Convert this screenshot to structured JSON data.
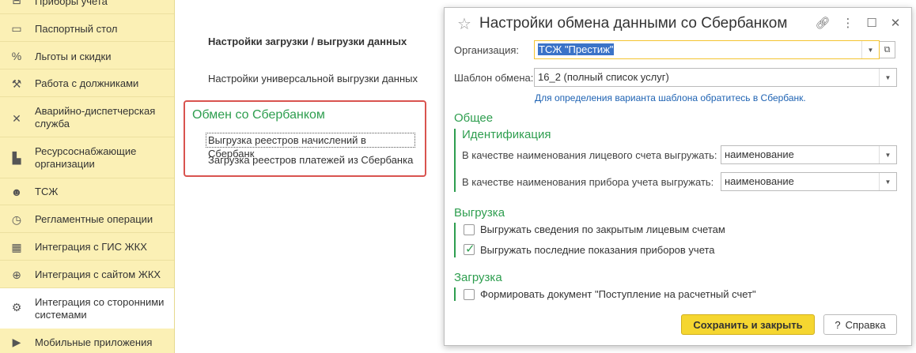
{
  "sidebar": {
    "items": [
      {
        "label": "Приборы учета",
        "icon": "meter-icon"
      },
      {
        "label": "Паспортный стол",
        "icon": "passport-icon"
      },
      {
        "label": "Льготы и скидки",
        "icon": "percent-icon"
      },
      {
        "label": "Работа с должниками",
        "icon": "gavel-icon"
      },
      {
        "label": "Аварийно-диспетчерская служба",
        "icon": "wrench-icon"
      },
      {
        "label": "Ресурсоснабжающие организации",
        "icon": "factory-icon"
      },
      {
        "label": "ТСЖ",
        "icon": "people-icon"
      },
      {
        "label": "Регламентные операции",
        "icon": "clock-icon"
      },
      {
        "label": "Интеграция с ГИС ЖКХ",
        "icon": "building-icon"
      },
      {
        "label": "Интеграция с сайтом ЖКХ",
        "icon": "globe-icon"
      },
      {
        "label": "Интеграция со сторонними системами",
        "icon": "gear-icon"
      },
      {
        "label": "Мобильные приложения",
        "icon": "play-icon"
      }
    ]
  },
  "middle": {
    "title": "Настройки загрузки / выгрузки данных",
    "universal_link": "Настройки универсальной выгрузки данных",
    "sber_title": "Обмен со Сбербанком",
    "sber_link1": "Выгрузка реестров начислений в Сбербанк",
    "sber_link2": "Загрузка реестров платежей из Сбербанка"
  },
  "dialog": {
    "title": "Настройки обмена данными со Сбербанком",
    "org_label": "Организация:",
    "org_value": "ТСЖ \"Престиж\"",
    "template_label": "Шаблон обмена:",
    "template_value": "16_2 (полный список услуг)",
    "hint": "Для определения варианта шаблона обратитесь в Сбербанк.",
    "general": "Общее",
    "identification": "Идентификация",
    "account_label": "В качестве наименования лицевого счета выгружать:",
    "account_value": "наименование",
    "meter_label": "В качестве наименования прибора учета выгружать:",
    "meter_value": "наименование",
    "export": "Выгрузка",
    "chk1_label": "Выгружать сведения по закрытым лицевым счетам",
    "chk1_checked": false,
    "chk2_label": "Выгружать последние показания приборов учета",
    "chk2_checked": true,
    "import": "Загрузка",
    "chk3_label": "Формировать документ \"Поступление на расчетный счет\"",
    "chk3_checked": false,
    "save_label": "Сохранить и закрыть",
    "help_label": "Справка"
  },
  "colors": {
    "sidebar_bg": "#fbf0b5",
    "accent_green": "#2e9e4f",
    "highlight_red": "#d9534f",
    "save_yellow": "#f5d630",
    "link_blue": "#1f63b3"
  }
}
